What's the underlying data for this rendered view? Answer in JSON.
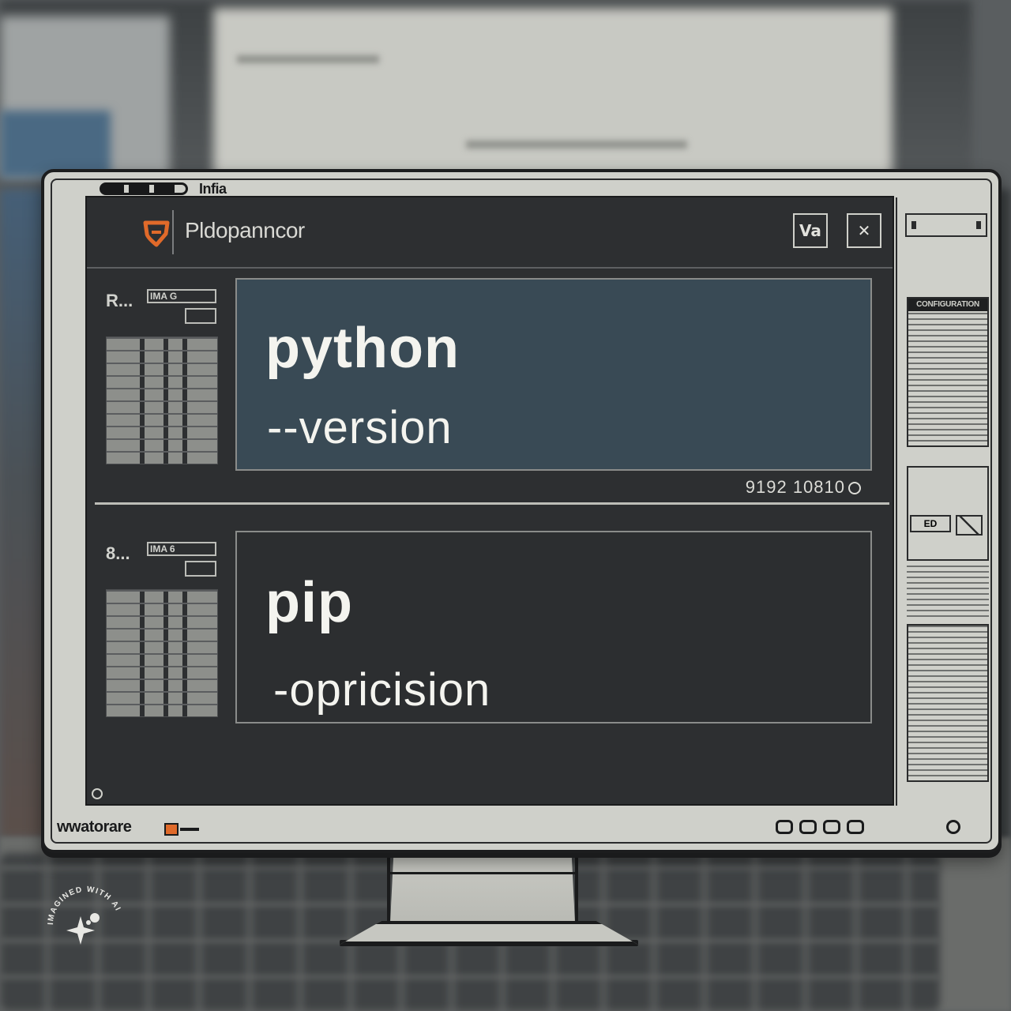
{
  "bezel_top": {
    "label": "Infia"
  },
  "app": {
    "title": "Pldopanncor",
    "header_buttons": [
      {
        "label": "Va"
      },
      {
        "label": "✕"
      }
    ]
  },
  "sections": [
    {
      "mini_label": "R...",
      "mini_head": "IMA G",
      "command": "python",
      "argument": "--version",
      "ref": "9192 10810"
    },
    {
      "mini_label": "8...",
      "mini_head": "IMA 6",
      "command": "pip",
      "argument": "-opricision"
    }
  ],
  "sidebar": {
    "panel_title": "CONFIGURATION",
    "tag": "ED"
  },
  "bezel_bottom": {
    "label": "wwatorare"
  },
  "watermark": {
    "text": "IMAGINED WITH AI"
  },
  "colors": {
    "screen_bg": "#2d2f31",
    "active_box": "#394a55",
    "accent_orange": "#e06a2a",
    "bezel": "#cfd0ca"
  }
}
